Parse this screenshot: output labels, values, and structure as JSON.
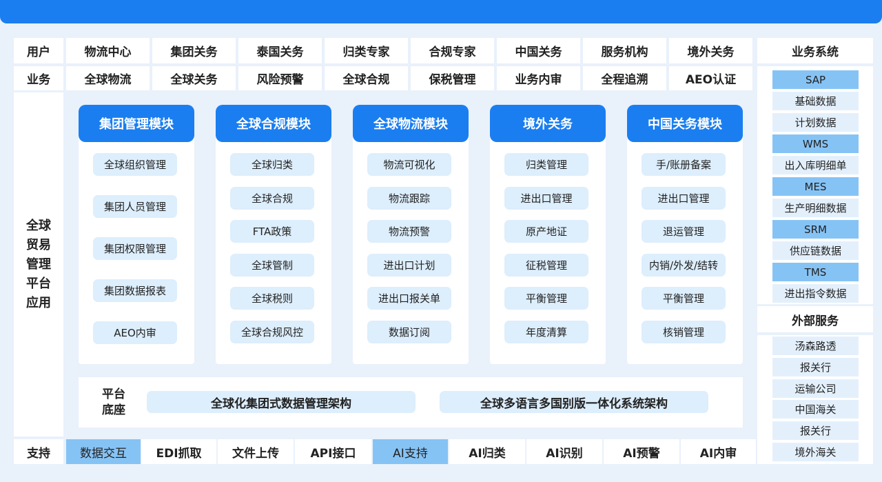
{
  "header_row": {
    "label": "用户",
    "items": [
      "物流中心",
      "集团关务",
      "泰国关务",
      "归类专家",
      "合规专家",
      "中国关务",
      "服务机构",
      "境外关务"
    ],
    "right_title": "业务系统"
  },
  "business_row": {
    "label": "业务",
    "items": [
      "全球物流",
      "全球关务",
      "风险预警",
      "全球合规",
      "保税管理",
      "业务内审",
      "全程追溯",
      "AEO认证"
    ]
  },
  "left_label": "全球贸易管理平台应用",
  "modules": [
    {
      "title": "集团管理模块",
      "items": [
        "全球组织管理",
        "集团人员管理",
        "集团权限管理",
        "集团数据报表",
        "AEO内审"
      ]
    },
    {
      "title": "全球合规模块",
      "items": [
        "全球归类",
        "全球合规",
        "FTA政策",
        "全球管制",
        "全球税则",
        "全球合规风控"
      ]
    },
    {
      "title": "全球物流模块",
      "items": [
        "物流可视化",
        "物流跟踪",
        "物流预警",
        "进出口计划",
        "进出口报关单",
        "数据订阅"
      ]
    },
    {
      "title": "境外关务",
      "items": [
        "归类管理",
        "进出口管理",
        "原产地证",
        "征税管理",
        "平衡管理",
        "年度清算"
      ]
    },
    {
      "title": "中国关务模块",
      "items": [
        "手/账册备案",
        "进出口管理",
        "退运管理",
        "内销/外发/结转",
        "平衡管理",
        "核销管理"
      ]
    }
  ],
  "platform_base": {
    "label": "平台底座",
    "items": [
      "全球化集团式数据管理架构",
      "全球多语言多国别版一体化系统架构"
    ]
  },
  "support_row": {
    "label": "支持",
    "items": [
      "数据交互",
      "EDI抓取",
      "文件上传",
      "API接口",
      "AI支持",
      "AI归类",
      "AI识别",
      "AI预警",
      "AI内审"
    ],
    "highlighted": [
      0,
      4
    ]
  },
  "business_systems": [
    "SAP",
    "基础数据",
    "计划数据",
    "WMS",
    "出入库明细单",
    "MES",
    "生产明细数据",
    "SRM",
    "供应链数据",
    "TMS",
    "进出指令数据"
  ],
  "business_systems_highlighted": [
    0,
    3,
    5,
    7,
    9
  ],
  "external_services": {
    "title": "外部服务",
    "items": [
      "汤森路透",
      "报关行",
      "运输公司",
      "中国海关",
      "报关行",
      "境外海关"
    ]
  },
  "colors": {
    "accent": "#1a7ef0",
    "highlight": "#86c3f5",
    "pill": "#ddeefc",
    "background": "#e9f1fb"
  }
}
